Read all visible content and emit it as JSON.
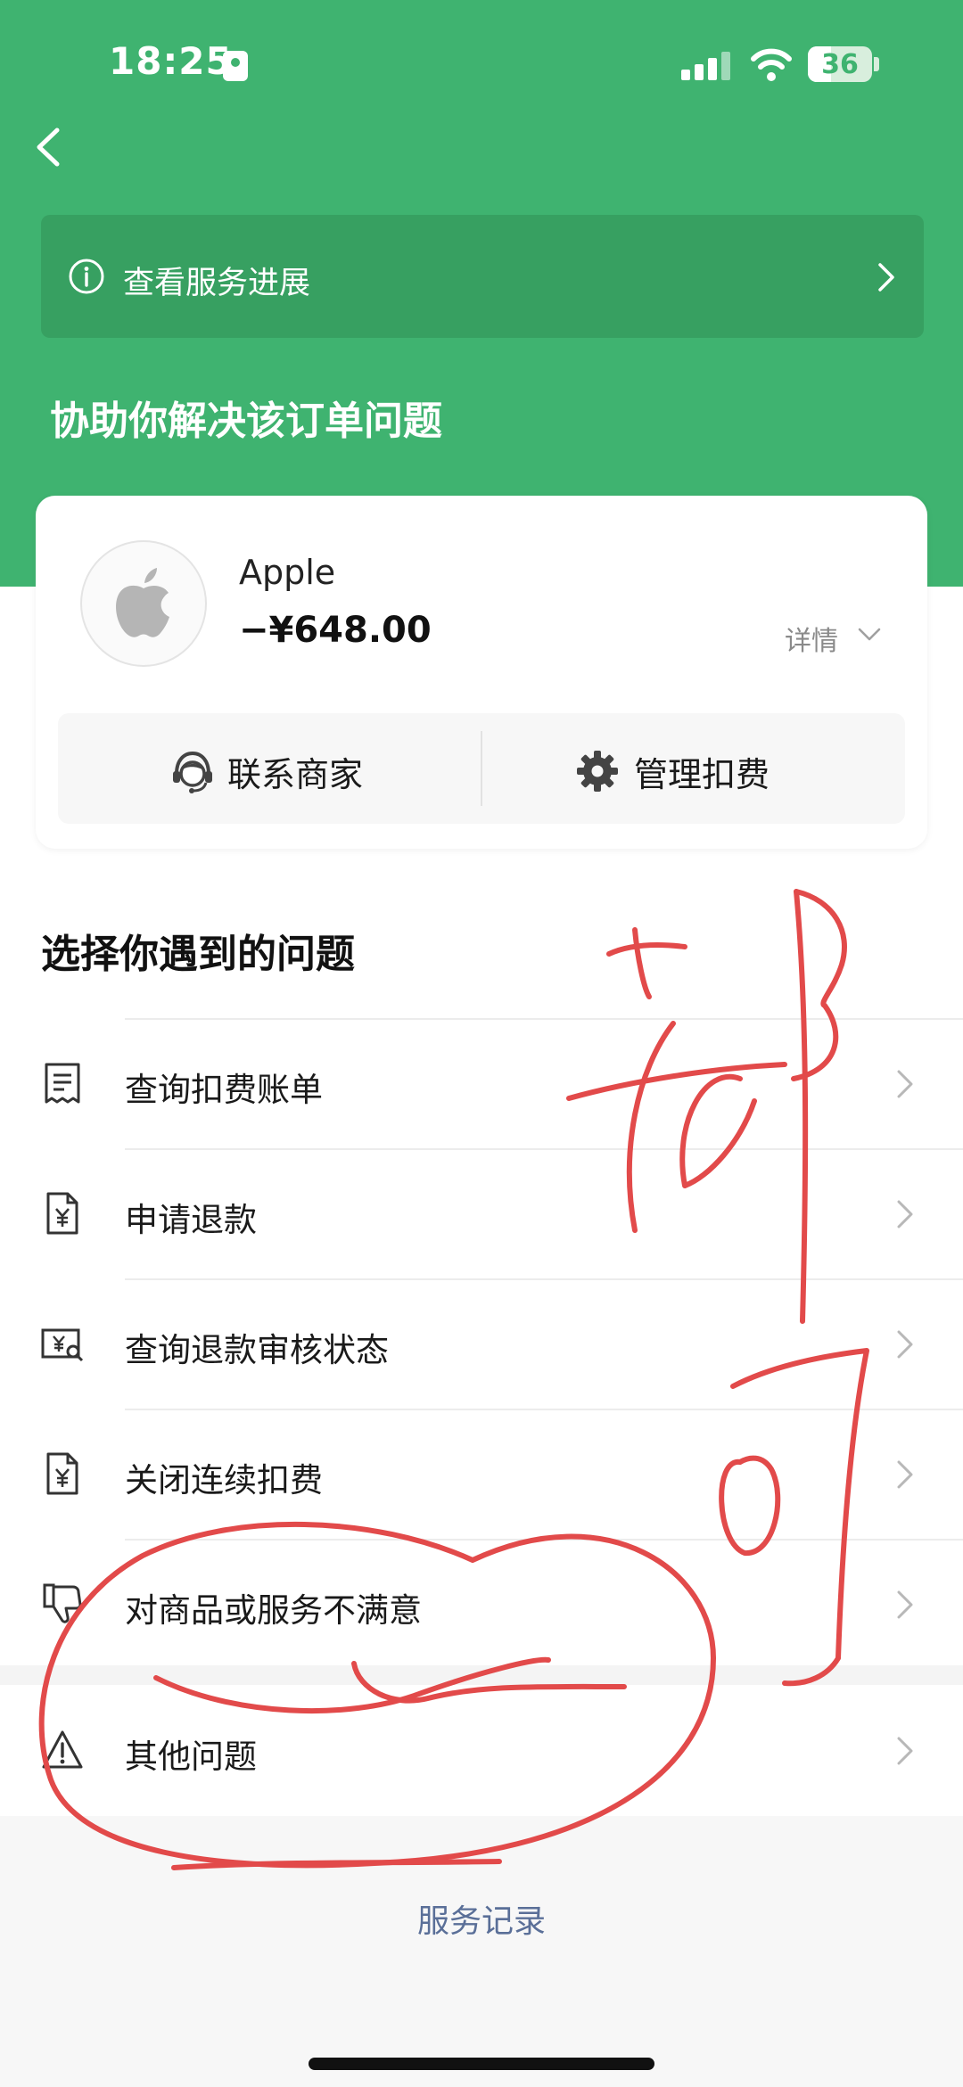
{
  "status_bar": {
    "time": "18:25",
    "battery": "36",
    "battery_level": 0.36
  },
  "banner": {
    "label": "查看服务进展"
  },
  "page_title": "协助你解决该订单问题",
  "merchant": {
    "name": "Apple",
    "amount": "−¥648.00",
    "details_label": "详情",
    "actions": {
      "contact": "联系商家",
      "manage": "管理扣费"
    }
  },
  "issues": {
    "title": "选择你遇到的问题",
    "items": [
      {
        "label": "查询扣费账单",
        "icon": "receipt-icon"
      },
      {
        "label": "申请退款",
        "icon": "refund-document-icon"
      },
      {
        "label": "查询退款审核状态",
        "icon": "refund-review-icon"
      },
      {
        "label": "关闭连续扣费",
        "icon": "subscription-document-icon"
      },
      {
        "label": "对商品或服务不满意",
        "icon": "thumbs-down-icon"
      },
      {
        "label": "其他问题",
        "icon": "warning-icon"
      }
    ]
  },
  "footer": {
    "service_record": "服务记录"
  },
  "colors": {
    "brand_green": "#3fb370",
    "banner_green": "#37a061",
    "link_blue": "#5a6f98",
    "annotation_red": "#e24a4a"
  }
}
